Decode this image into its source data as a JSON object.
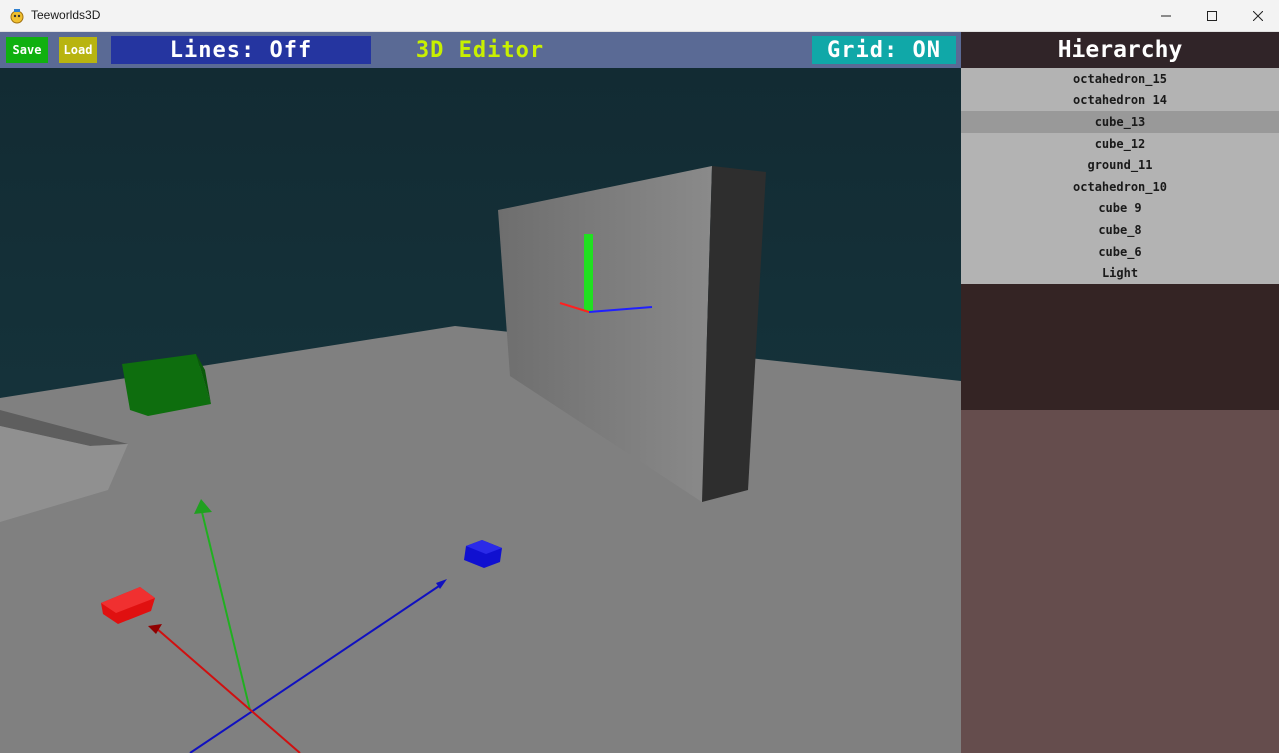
{
  "window": {
    "title": "Teeworlds3D",
    "minimize_icon": "minimize-icon",
    "maximize_icon": "maximize-icon",
    "close_icon": "close-icon"
  },
  "toolbar": {
    "save_label": "Save",
    "load_label": "Load",
    "lines_label": "Lines: Off",
    "editor_title": "3D Editor",
    "grid_label": "Grid: ON",
    "colors": {
      "save": "#10b010",
      "load": "#b8b410",
      "lines": "#2535a0",
      "editor_title": "#c8f000",
      "grid": "#10a8a8"
    }
  },
  "hierarchy": {
    "title": "Hierarchy",
    "items": [
      {
        "label": "octahedron_15"
      },
      {
        "label": "octahedron 14"
      },
      {
        "label": "cube_13",
        "selected": true
      },
      {
        "label": "cube_12"
      },
      {
        "label": "ground_11"
      },
      {
        "label": "octahedron_10"
      },
      {
        "label": "cube 9"
      },
      {
        "label": "cube_8"
      },
      {
        "label": "cube_6"
      },
      {
        "label": "Light"
      }
    ]
  },
  "scene": {
    "sky_color": "#152a30",
    "ground_color": "#808080"
  }
}
